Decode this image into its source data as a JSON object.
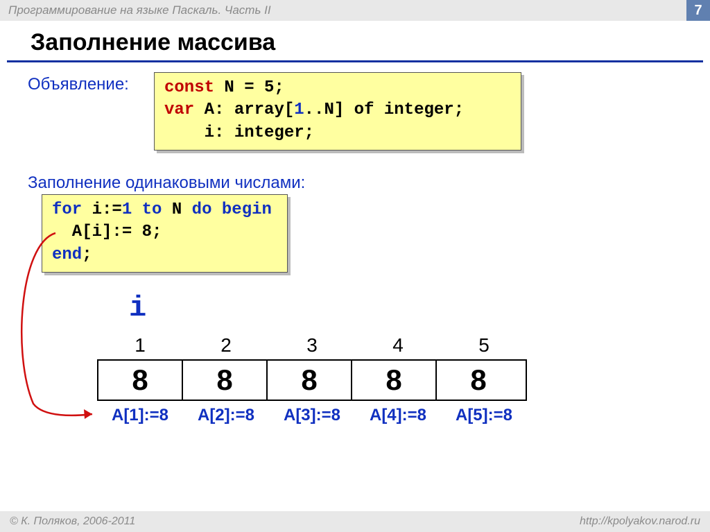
{
  "header": {
    "course": "Программирование на языке Паскаль. Часть II",
    "page": "7"
  },
  "title": "Заполнение массива",
  "declaration": {
    "label": "Объявление:",
    "code": {
      "const_kw": "const",
      "const_rest": " N = 5;",
      "var_kw": "var",
      "var_mid": " A: array[",
      "one": "1",
      "var_rest": "..N] of integer;",
      "line3": "    i: integer;"
    }
  },
  "fill": {
    "label": "Заполнение одинаковыми числами:",
    "code": {
      "for_kw": "for",
      "mid1": " i:=",
      "one": "1",
      "mid2": " ",
      "to_kw": "to",
      "mid3": " N ",
      "do_kw": "do",
      "mid4": " ",
      "begin_kw": "begin",
      "line2": "  A[i]:= 8;",
      "end_kw": "end",
      "semi": ";"
    }
  },
  "diagram": {
    "i_label": "i",
    "indices": [
      "1",
      "2",
      "3",
      "4",
      "5"
    ],
    "values": [
      "8",
      "8",
      "8",
      "8",
      "8"
    ],
    "assigns": [
      "A[1]:=8",
      "A[2]:=8",
      "A[3]:=8",
      "A[4]:=8",
      "A[5]:=8"
    ]
  },
  "footer": {
    "copyright": "© К. Поляков, 2006-2011",
    "url": "http://kpolyakov.narod.ru"
  }
}
